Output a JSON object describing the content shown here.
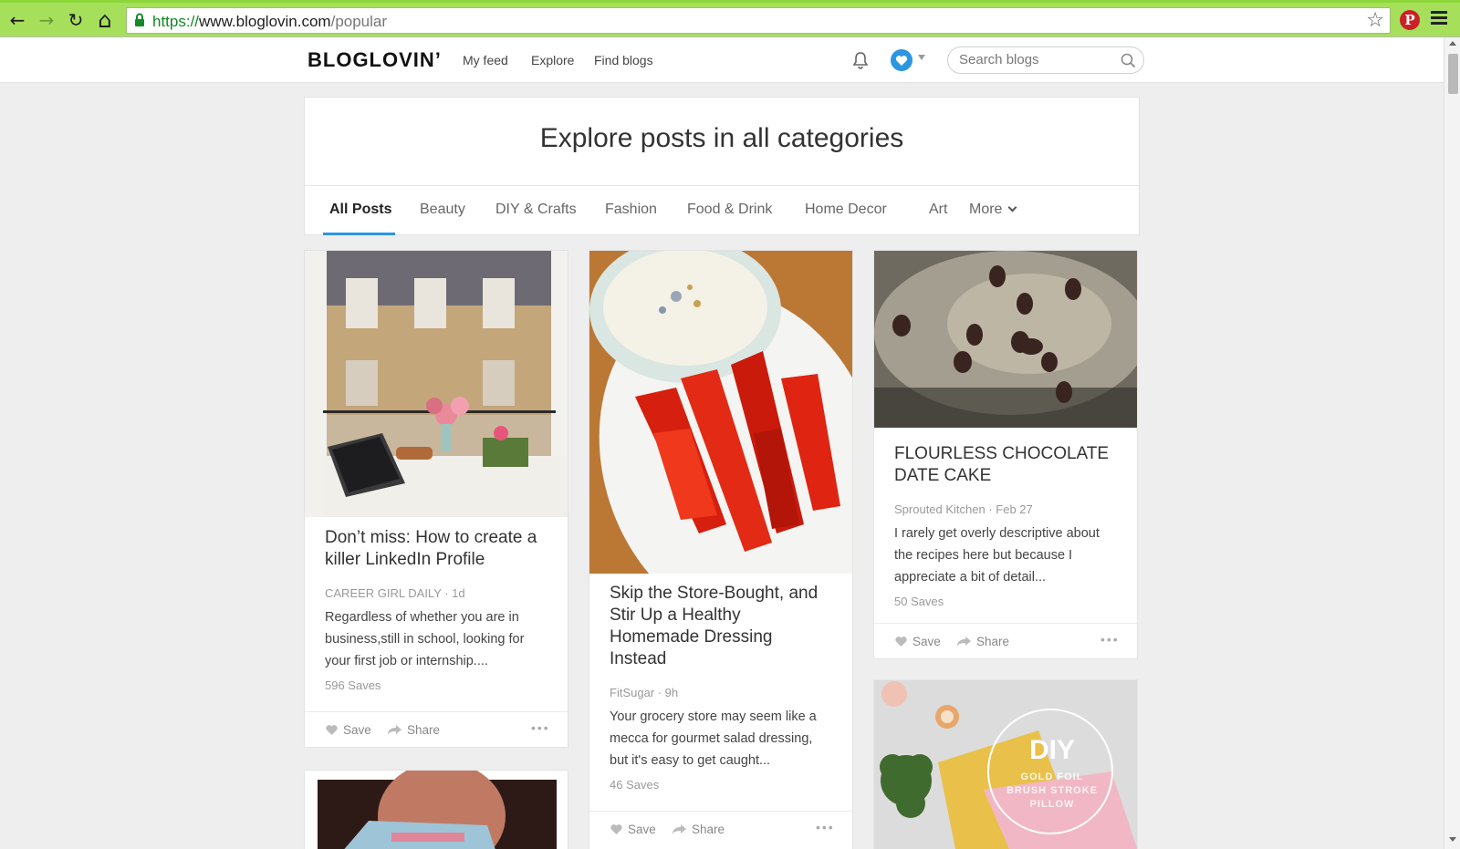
{
  "browser": {
    "url_proto": "https://",
    "url_host": "www.bloglovin.com",
    "url_path": "/popular",
    "back_icon": "←",
    "forward_icon": "→",
    "reload_icon": "↻",
    "home_icon": "⌂",
    "bookmark_icon": "☆",
    "pinterest_icon": "P"
  },
  "header": {
    "logo": "BLOGLOVIN’",
    "nav": [
      "My feed",
      "Explore",
      "Find blogs"
    ],
    "search_placeholder": "Search blogs"
  },
  "hero": {
    "title": "Explore posts in all categories",
    "tabs": [
      "All Posts",
      "Beauty",
      "DIY & Crafts",
      "Fashion",
      "Food & Drink",
      "Home Decor",
      "Art",
      "More"
    ],
    "active_tab": "All Posts"
  },
  "posts": [
    {
      "title": "Don’t miss: How to create a killer LinkedIn Profile",
      "meta": "CAREER GIRL DAILY · 1d",
      "excerpt": "Regardless of whether you are in business,still in school, looking for your first job or internship....",
      "saves": "596 Saves",
      "save_label": "Save",
      "share_label": "Share"
    },
    {
      "title": "Skip the Store-Bought, and Stir Up a Healthy Homemade Dressing Instead",
      "meta": "FitSugar · 9h",
      "excerpt": "Your grocery store may seem like a mecca for gourmet salad dressing, but it's easy to get caught...",
      "saves": "46 Saves",
      "save_label": "Save",
      "share_label": "Share"
    },
    {
      "title": "FLOURLESS CHOCOLATE DATE CAKE",
      "meta": "Sprouted Kitchen · Feb 27",
      "excerpt": "I rarely get overly descriptive about the recipes here but because I appreciate a bit of detail...",
      "saves": "50 Saves",
      "save_label": "Save",
      "share_label": "Share"
    }
  ],
  "diy_card": {
    "headline": "DIY",
    "subline1": "GOLD FOIL",
    "subline2": "BRUSH STROKE",
    "subline3": "PILLOW"
  },
  "colors": {
    "accent": "#2b96e2",
    "chrome_green": "#a6e05a",
    "pinterest_red": "#cb2027"
  }
}
